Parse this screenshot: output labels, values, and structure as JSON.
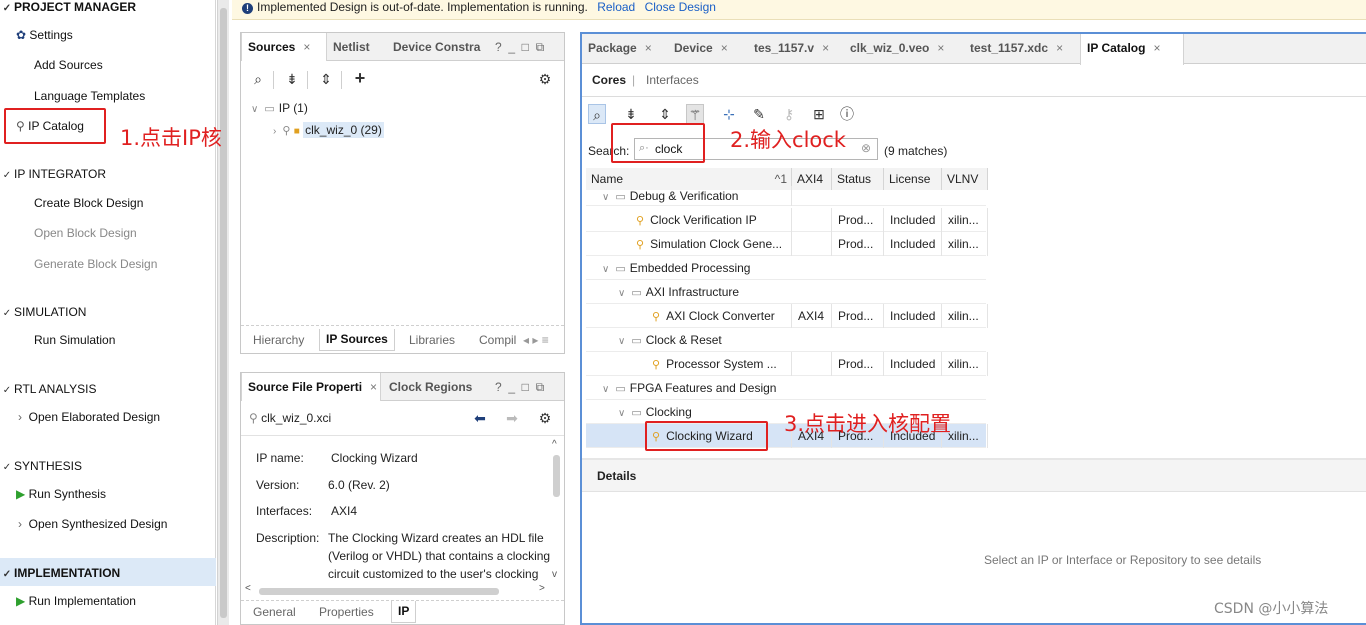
{
  "banner": {
    "message": "Implemented Design is out-of-date. Implementation is running.",
    "reload": "Reload",
    "close_design": "Close Design"
  },
  "flow_navigator": {
    "project_manager": "PROJECT MANAGER",
    "settings": "Settings",
    "add_sources": "Add Sources",
    "language_templates": "Language Templates",
    "ip_catalog": "IP Catalog",
    "ip_integrator": "IP INTEGRATOR",
    "create_block_design": "Create Block Design",
    "open_block_design": "Open Block Design",
    "generate_block_design": "Generate Block Design",
    "simulation": "SIMULATION",
    "run_simulation": "Run Simulation",
    "rtl_analysis": "RTL ANALYSIS",
    "open_elaborated_design": "Open Elaborated Design",
    "synthesis": "SYNTHESIS",
    "run_synthesis": "Run Synthesis",
    "open_synthesized_design": "Open Synthesized Design",
    "implementation": "IMPLEMENTATION",
    "run_implementation": "Run Implementation"
  },
  "sources_panel": {
    "tabs": [
      "Sources",
      "Netlist",
      "Device Constra"
    ],
    "tree_root": "IP (1)",
    "tree_item": "clk_wiz_0 (29)",
    "bottom_tabs": [
      "Hierarchy",
      "IP Sources",
      "Libraries",
      "Compil"
    ]
  },
  "properties_panel": {
    "tabs": [
      "Source File Properti",
      "Clock Regions"
    ],
    "file": "clk_wiz_0.xci",
    "ip_name_label": "IP name:",
    "ip_name": "Clocking Wizard",
    "version_label": "Version:",
    "version": "6.0 (Rev. 2)",
    "interfaces_label": "Interfaces:",
    "interfaces": "AXI4",
    "description_label": "Description:",
    "description_lines": [
      "The Clocking Wizard creates an HDL file",
      "(Verilog or VHDL) that contains a clocking",
      "circuit customized to the user's clocking"
    ],
    "bottom_tabs": [
      "General",
      "Properties",
      "IP"
    ]
  },
  "main_panel": {
    "tabs": [
      "Package",
      "Device",
      "tes_1157.v",
      "clk_wiz_0.veo",
      "test_1157.xdc",
      "IP Catalog"
    ],
    "subtabs": [
      "Cores",
      "Interfaces"
    ],
    "search_label": "Search:",
    "search_value": "clock",
    "match_count": "(9 matches)",
    "columns": [
      "Name",
      "AXI4",
      "Status",
      "License",
      "VLNV"
    ],
    "sort_indicator": "1",
    "rows": [
      {
        "name": "Debug & Verification",
        "axi4": "",
        "status": "",
        "license": "",
        "vlnv": ""
      },
      {
        "name": "Clock Verification IP",
        "axi4": "",
        "status": "Prod...",
        "license": "Included",
        "vlnv": "xilin..."
      },
      {
        "name": "Simulation Clock Gene...",
        "axi4": "",
        "status": "Prod...",
        "license": "Included",
        "vlnv": "xilin..."
      },
      {
        "name": "Embedded Processing",
        "axi4": "",
        "status": "",
        "license": "",
        "vlnv": ""
      },
      {
        "name": "AXI Infrastructure",
        "axi4": "",
        "status": "",
        "license": "",
        "vlnv": ""
      },
      {
        "name": "AXI Clock Converter",
        "axi4": "AXI4",
        "status": "Prod...",
        "license": "Included",
        "vlnv": "xilin..."
      },
      {
        "name": "Clock & Reset",
        "axi4": "",
        "status": "",
        "license": "",
        "vlnv": ""
      },
      {
        "name": "Processor System ...",
        "axi4": "",
        "status": "Prod...",
        "license": "Included",
        "vlnv": "xilin..."
      },
      {
        "name": "FPGA Features and Design",
        "axi4": "",
        "status": "",
        "license": "",
        "vlnv": ""
      },
      {
        "name": "Clocking",
        "axi4": "",
        "status": "",
        "license": "",
        "vlnv": ""
      },
      {
        "name": "Clocking Wizard",
        "axi4": "AXI4",
        "status": "Prod...",
        "license": "Included",
        "vlnv": "xilin..."
      }
    ],
    "details_title": "Details",
    "details_empty": "Select an IP or Interface or Repository to see details"
  },
  "annotations": {
    "step1": "1.点击IP核",
    "step2": "2.输入clock",
    "step3": "3.点击进入核配置",
    "color": "#e02020"
  },
  "watermark": "CSDN @小小算法"
}
